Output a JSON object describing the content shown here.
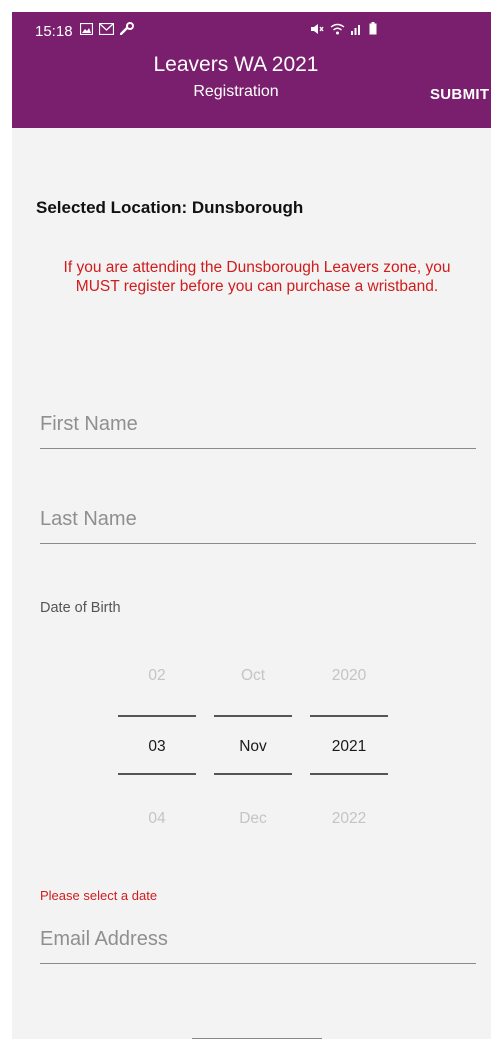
{
  "status_bar": {
    "time": "15:18",
    "left_icons": [
      "gallery-icon",
      "gmail-icon",
      "wrench-icon"
    ],
    "right_icons": [
      "mute-icon",
      "wifi-icon",
      "signal-icon",
      "battery-icon"
    ]
  },
  "app_bar": {
    "title": "Leavers WA 2021",
    "subtitle": "Registration",
    "submit_label": "SUBMIT",
    "color": "#7a1f6e"
  },
  "form": {
    "selected_location": "Selected Location: Dunsborough",
    "warning": "If you are attending the Dunsborough Leavers zone, you MUST register before you can purchase a wristband.",
    "first_name_placeholder": "First Name",
    "last_name_placeholder": "Last Name",
    "dob_label": "Date of Birth",
    "date_picker": {
      "day": {
        "prev": "02",
        "selected": "03",
        "next": "04"
      },
      "month": {
        "prev": "Oct",
        "selected": "Nov",
        "next": "Dec"
      },
      "year": {
        "prev": "2020",
        "selected": "2021",
        "next": "2022"
      }
    },
    "date_error": "Please select a date",
    "email_placeholder": "Email Address"
  },
  "colors": {
    "error": "#d01c1c",
    "background": "#f3f3f3"
  }
}
